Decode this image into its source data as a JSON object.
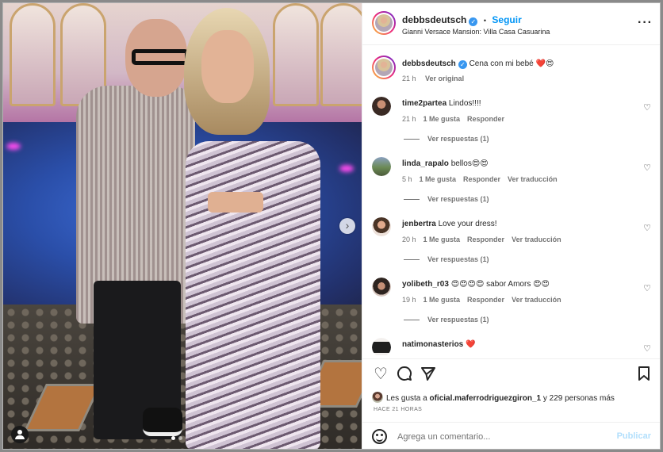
{
  "header": {
    "username": "debbsdeutsch",
    "separator": "•",
    "follow_label": "Seguir",
    "location": "Gianni Versace Mansion: Villa Casa Casuarina",
    "more_icon": "more-horizontal-icon"
  },
  "caption": {
    "username": "debbsdeutsch",
    "text": "Cena con mi bebé ❤️😍",
    "time": "21 h",
    "see_translation": "Ver original"
  },
  "comments": [
    {
      "username": "time2partea",
      "text": "Lindos!!!!",
      "time": "21 h",
      "likes": "1 Me gusta",
      "reply": "Responder",
      "translate": "",
      "replies": "Ver respuestas (1)"
    },
    {
      "username": "linda_rapalo",
      "text": "bellos😍😍",
      "time": "5 h",
      "likes": "1 Me gusta",
      "reply": "Responder",
      "translate": "Ver traducción",
      "replies": "Ver respuestas (1)"
    },
    {
      "username": "jenbertra",
      "text": "Love your dress!",
      "time": "20 h",
      "likes": "1 Me gusta",
      "reply": "Responder",
      "translate": "Ver traducción",
      "replies": "Ver respuestas (1)"
    },
    {
      "username": "yolibeth_r03",
      "text": "😍😍😍😍 sabor Amors 😍😍",
      "time": "19 h",
      "likes": "1 Me gusta",
      "reply": "Responder",
      "translate": "Ver traducción",
      "replies": "Ver respuestas (1)"
    },
    {
      "username": "natimonasterios",
      "text": "❤️",
      "time": "",
      "likes": "",
      "reply": "",
      "translate": "",
      "replies": ""
    }
  ],
  "likes": {
    "prefix": "Les gusta a ",
    "user": "oficial.maferrodriguezgiron_1",
    "suffix": " y 229 personas más"
  },
  "time_ago": "HACE 21 HORAS",
  "composer": {
    "placeholder": "Agrega un comentario...",
    "post_label": "Publicar"
  },
  "colors": {
    "link": "#0095f6",
    "verified": "#3897f0",
    "post_disabled": "#b2dffc"
  }
}
